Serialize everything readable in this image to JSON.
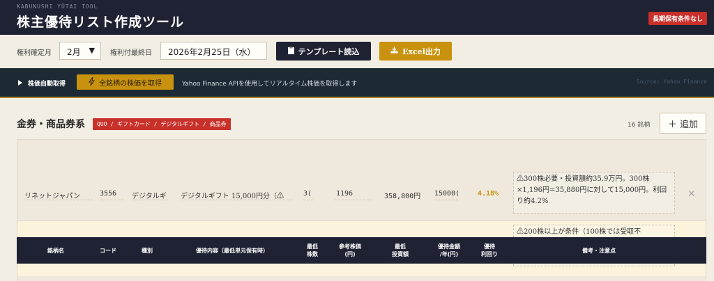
{
  "header": {
    "brand": "KABUNUSHI YŪTAI TOOL",
    "title": "株主優待リスト作成ツール",
    "badge": "長期保有条件なし"
  },
  "controls": {
    "month_label": "権利確定月",
    "month_value": "2月",
    "last_day_label": "権利付最終日",
    "last_day_value": "2026年2月25日（水）",
    "template_button": "テンプレート読込",
    "excel_button": "Excel出力"
  },
  "stockbar": {
    "auto_label": "株価自動取得",
    "fetch_button": "全銘柄の株価を取得",
    "description": "Yahoo Finance APIを使用してリアルタイム株価を取得します",
    "source": "Source: Yahoo Finance"
  },
  "section": {
    "title": "金券・商品券系",
    "tag": "QUO / ギフトカード / デジタルギフト / 商品券",
    "count": "16 銘柄",
    "add_button": "追加"
  },
  "rows": [
    {
      "name": "リネットジャパン",
      "code": "3556",
      "kind": "デジタルギ",
      "content": "デジタルギフト 15,000円分（⚠",
      "min_shares": "3(",
      "price": "1196",
      "min_investment": "358,800円",
      "gift_amount": "15000(",
      "yield": "4.18%",
      "note": "⚠300株必要・投資額約35.9万円。300株×1,196円=35,880円に対して15,000円。利回り約4.2%"
    },
    {
      "note": "⚠200株以上が条件（100株では受取不"
    }
  ],
  "table_header": {
    "name": "銘柄名",
    "code": "コード",
    "kind": "種別",
    "content": "優待内容（最低単元保有時）",
    "min_shares": "最低\n株数",
    "ref_price": "参考株価\n(円)",
    "min_investment": "最低\n投資額",
    "gift_amount": "優待金額\n/年(円)",
    "yield": "優待\n利回り",
    "note": "備考・注意点"
  },
  "colors": {
    "navy": "#1e2233",
    "gold": "#c9920e",
    "red": "#c8302a"
  }
}
